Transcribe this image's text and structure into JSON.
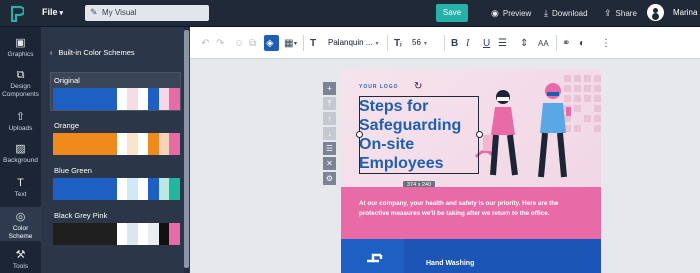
{
  "app": {
    "file_menu": "File",
    "document_title": "My Visual",
    "save_label": "Save",
    "preview_label": "Preview",
    "download_label": "Download",
    "share_label": "Share",
    "user_name": "Marina",
    "brand_color": "#25b0a8"
  },
  "rail": {
    "items": [
      {
        "label": "Graphics",
        "icon": "graphics-icon"
      },
      {
        "label": "Design Components",
        "icon": "design-components-icon"
      },
      {
        "label": "Uploads",
        "icon": "uploads-icon"
      },
      {
        "label": "Background",
        "icon": "background-icon"
      },
      {
        "label": "Text",
        "icon": "text-icon"
      },
      {
        "label": "Color Scheme",
        "icon": "color-scheme-icon",
        "active": true
      },
      {
        "label": "Tools",
        "icon": "tools-icon"
      }
    ]
  },
  "panel": {
    "title": "Built-in Color Schemes",
    "schemes": [
      {
        "name": "Original",
        "selected": true,
        "colors": [
          "#1e5fc4",
          "#1e5fc4",
          "#ffffff",
          "#f5dde8",
          "#ffffff",
          "#1e5fc4",
          "#f6d7e5",
          "#e86aa6"
        ]
      },
      {
        "name": "Orange",
        "colors": [
          "#f08a1c",
          "#f08a1c",
          "#ffffff",
          "#fbe3cc",
          "#ffffff",
          "#f08a1c",
          "#f7d3ba",
          "#e86aa6"
        ]
      },
      {
        "name": "Blue Green",
        "colors": [
          "#1e5fc4",
          "#1e5fc4",
          "#ffffff",
          "#cfeaf5",
          "#ffffff",
          "#1e5fc4",
          "#bde7e3",
          "#1fb89f"
        ]
      },
      {
        "name": "Black Grey Pink",
        "colors": [
          "#1f1f1f",
          "#1f1f1f",
          "#ffffff",
          "#dde6ee",
          "#ffffff",
          "#e9eef3",
          "#111111",
          "#e86aa6"
        ]
      }
    ]
  },
  "toolbar": {
    "font_name": "Palanquin ...",
    "font_size": "56"
  },
  "poster": {
    "logo_text": "YOUR LOGO",
    "heading": "Steps for Safeguarding On-site Employees",
    "size_label": "374 x 240",
    "body": "At our company, your health and safety is our priority. Here are the protective measures we'll be taking after we return to the office.",
    "section_label": "Hand Washing",
    "colors": {
      "primary": "#1e5fb4",
      "accent": "#e86aa6",
      "soft": "#f3dde8"
    }
  }
}
